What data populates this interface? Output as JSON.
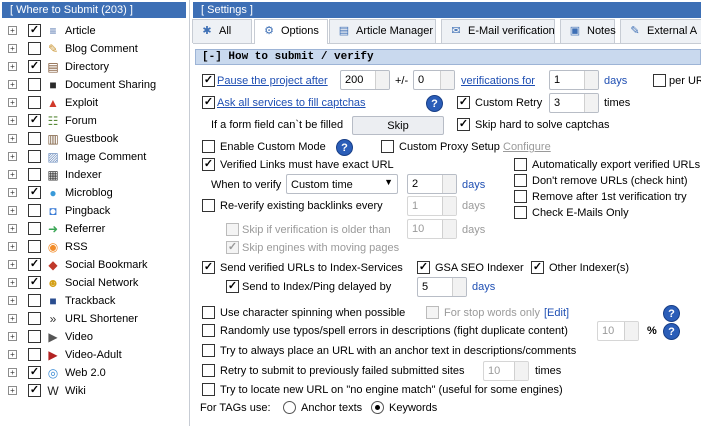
{
  "left_panel": {
    "header": "[ Where to Submit  (203) ]",
    "items": [
      {
        "label": "Article",
        "checked": true,
        "icon": "article-icon",
        "glyph": "≡",
        "color": "#4a6da8"
      },
      {
        "label": "Blog Comment",
        "checked": false,
        "icon": "blog-comment-icon",
        "glyph": "✎",
        "color": "#c8922d"
      },
      {
        "label": "Directory",
        "checked": true,
        "icon": "directory-icon",
        "glyph": "▤",
        "color": "#7a4f2c"
      },
      {
        "label": "Document Sharing",
        "checked": false,
        "icon": "document-sharing-icon",
        "glyph": "■",
        "color": "#2b2b2b"
      },
      {
        "label": "Exploit",
        "checked": false,
        "icon": "exploit-icon",
        "glyph": "▲",
        "color": "#d13a2a"
      },
      {
        "label": "Forum",
        "checked": true,
        "icon": "forum-icon",
        "glyph": "☷",
        "color": "#5a8a3a"
      },
      {
        "label": "Guestbook",
        "checked": false,
        "icon": "guestbook-icon",
        "glyph": "▥",
        "color": "#7a5a3a"
      },
      {
        "label": "Image Comment",
        "checked": false,
        "icon": "image-comment-icon",
        "glyph": "▨",
        "color": "#6f8fbf"
      },
      {
        "label": "Indexer",
        "checked": false,
        "icon": "indexer-icon",
        "glyph": "▦",
        "color": "#3a3a3a"
      },
      {
        "label": "Microblog",
        "checked": true,
        "icon": "microblog-icon",
        "glyph": "●",
        "color": "#3a9ad9"
      },
      {
        "label": "Pingback",
        "checked": false,
        "icon": "pingback-icon",
        "glyph": "◘",
        "color": "#3a7bd5"
      },
      {
        "label": "Referrer",
        "checked": false,
        "icon": "referrer-icon",
        "glyph": "➜",
        "color": "#3aa655"
      },
      {
        "label": "RSS",
        "checked": false,
        "icon": "rss-icon",
        "glyph": "◉",
        "color": "#f28c28"
      },
      {
        "label": "Social Bookmark",
        "checked": true,
        "icon": "social-bookmark-icon",
        "glyph": "◆",
        "color": "#c0392b"
      },
      {
        "label": "Social Network",
        "checked": true,
        "icon": "social-network-icon",
        "glyph": "☻",
        "color": "#d4a017"
      },
      {
        "label": "Trackback",
        "checked": false,
        "icon": "trackback-icon",
        "glyph": "■",
        "color": "#2a4d8f"
      },
      {
        "label": "URL Shortener",
        "checked": false,
        "icon": "url-shortener-icon",
        "glyph": "»",
        "color": "#333333"
      },
      {
        "label": "Video",
        "checked": false,
        "icon": "video-icon",
        "glyph": "▶",
        "color": "#555555"
      },
      {
        "label": "Video-Adult",
        "checked": false,
        "icon": "video-adult-icon",
        "glyph": "▶",
        "color": "#b22222"
      },
      {
        "label": "Web 2.0",
        "checked": true,
        "icon": "web20-icon",
        "glyph": "◎",
        "color": "#3a8bd5"
      },
      {
        "label": "Wiki",
        "checked": true,
        "icon": "wiki-icon",
        "glyph": "W",
        "color": "#222222"
      }
    ]
  },
  "settings": {
    "header": "[ Settings ]",
    "tabs": [
      {
        "label": "All",
        "icon": "all-icon",
        "glyph": "✱"
      },
      {
        "label": "Options",
        "icon": "gear-icon",
        "glyph": "⚙"
      },
      {
        "label": "Article Manager",
        "icon": "article-manager-icon",
        "glyph": "▤"
      },
      {
        "label": "E-Mail verification",
        "icon": "email-icon",
        "glyph": "✉"
      },
      {
        "label": "Notes",
        "icon": "notes-icon",
        "glyph": "▣"
      },
      {
        "label": "External A",
        "icon": "external-icon",
        "glyph": "✎"
      }
    ],
    "active_tab": "Options",
    "section_title": "[-] How to submit / verify",
    "pause": {
      "label": "Pause the project after",
      "value1": "200",
      "sep": "+/-",
      "value2": "0",
      "link": "verifications for",
      "value3": "1",
      "unit": "days",
      "per_label": "per UR"
    },
    "ask_all": {
      "label": "Ask all services to fill captchas"
    },
    "custom_retry": {
      "label": "Custom Retry",
      "value": "3",
      "unit": "times"
    },
    "form_field": {
      "label": "If a form field can`t be filled",
      "button": "Skip"
    },
    "skip_hard": {
      "label": "Skip hard to solve captchas"
    },
    "custom_mode": {
      "label": "Enable Custom Mode"
    },
    "proxy": {
      "label": "Custom Proxy Setup",
      "link": "Configure"
    },
    "verified_links": {
      "label": "Verified Links must have exact URL"
    },
    "when_verify": {
      "label": "When to verify",
      "select": "Custom time",
      "value": "2",
      "unit": "days"
    },
    "reverify": {
      "label": "Re-verify existing backlinks every",
      "value": "1",
      "unit": "days"
    },
    "skip_older": {
      "label": "Skip if verification is older than",
      "value": "10",
      "unit": "days"
    },
    "skip_moving": {
      "label": "Skip engines with moving pages"
    },
    "right_opts": [
      {
        "label": "Automatically export verified URLs"
      },
      {
        "label": "Don't remove URLs (check hint)"
      },
      {
        "label": "Remove after 1st verification try"
      },
      {
        "label": "Check E-Mails Only"
      }
    ],
    "send_index": {
      "label": "Send verified URLs to Index-Services",
      "gsa": "GSA SEO Indexer",
      "other": "Other Indexer(s)"
    },
    "send_ping": {
      "label": "Send to Index/Ping delayed by",
      "value": "5",
      "unit": "days"
    },
    "char_spin": {
      "label": "Use character spinning when possible",
      "stop": "For stop words only",
      "edit": "[Edit]"
    },
    "typos": {
      "label": "Randomly use typos/spell errors in descriptions (fight duplicate content)",
      "value": "10",
      "unit": "%"
    },
    "anchor_place": {
      "label": "Try to always place an URL with an anchor text in descriptions/comments"
    },
    "retry_failed": {
      "label": "Retry to submit to previously failed submitted sites",
      "value": "10",
      "unit": "times"
    },
    "locate_url": {
      "label": "Try to locate new URL on \"no engine match\" (useful for some engines)"
    },
    "tags": {
      "label": "For TAGs use:",
      "opt1": "Anchor texts",
      "opt2": "Keywords",
      "selected": "Keywords"
    }
  }
}
